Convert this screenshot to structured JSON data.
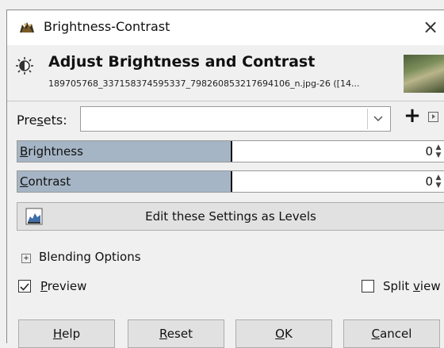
{
  "window": {
    "title": "Brightness-Contrast",
    "close_glyph": "×",
    "icon": "gimp-wilber-icon"
  },
  "header": {
    "title": "Adjust Brightness and Contrast",
    "subtitle": "189705768_337158374595337_7982608532176941​06_n.jpg-26 ([14...",
    "icon": "brightness-contrast-icon",
    "thumbnail": "image-thumbnail"
  },
  "presets": {
    "label_pre": "Pre",
    "label_mn": "s",
    "label_post": "ets:",
    "value": "",
    "add_glyph": "+",
    "menu_icon": "presets-menu-icon"
  },
  "brightness": {
    "label_mn": "B",
    "label_rest": "rightness",
    "value": "0",
    "fill_fraction": 0.5
  },
  "contrast": {
    "label_mn": "C",
    "label_rest": "ontrast",
    "value": "0",
    "fill_fraction": 0.5
  },
  "levels_button": {
    "label": "Edit these Settings as Levels",
    "icon": "levels-icon"
  },
  "blending": {
    "label": "Blending Options",
    "expander_glyph": "+"
  },
  "preview": {
    "checked": true,
    "label_mn": "P",
    "label_rest": "review"
  },
  "split_view": {
    "checked": false,
    "label_pre": "Split ",
    "label_mn": "v",
    "label_post": "iew"
  },
  "buttons": {
    "help": {
      "mn": "H",
      "rest": "elp"
    },
    "reset": {
      "mn": "R",
      "rest": "eset"
    },
    "ok": {
      "mn": "O",
      "rest": "K"
    },
    "cancel": {
      "mn": "C",
      "rest": "ancel"
    }
  },
  "colors": {
    "slider_fill": "#a5b5c5",
    "button_bg": "#e1e1e1",
    "window_bg": "#f0f0f0"
  }
}
